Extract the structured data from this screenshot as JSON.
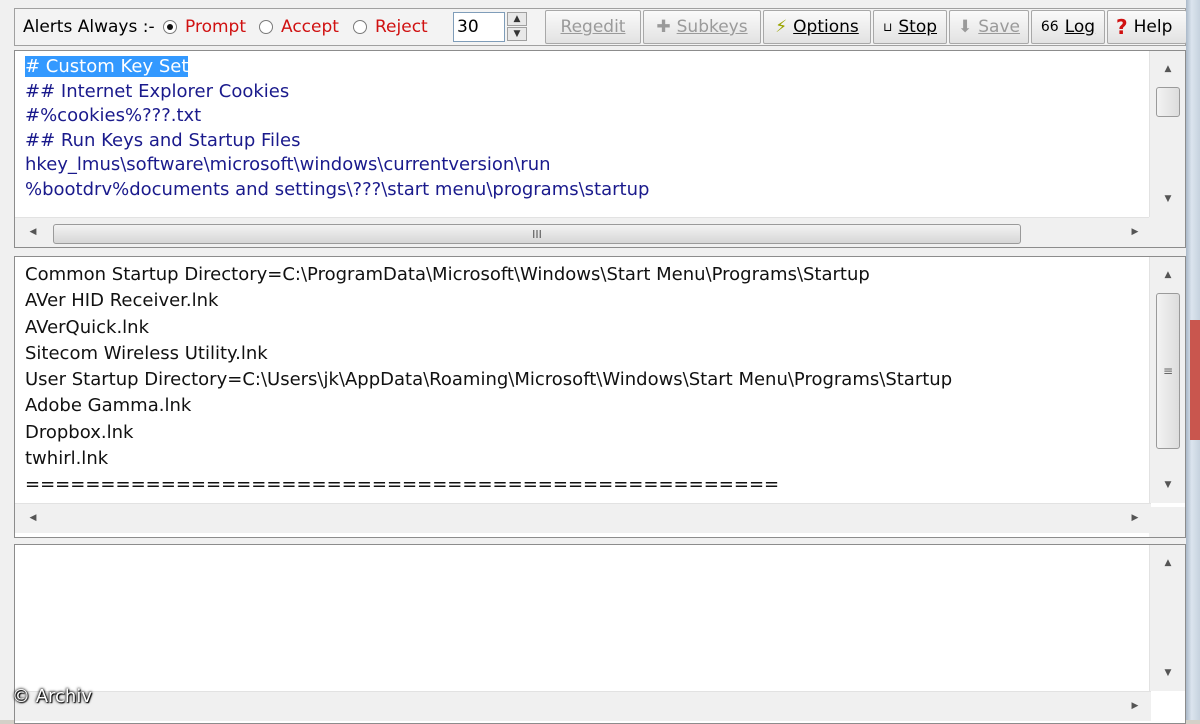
{
  "toolbar": {
    "alerts_label": "Alerts Always :-",
    "radios": [
      {
        "label": "Prompt",
        "selected": true
      },
      {
        "label": "Accept",
        "selected": false
      },
      {
        "label": "Reject",
        "selected": false
      }
    ],
    "timeout_value": "30",
    "buttons": {
      "regedit": "Regedit",
      "subkeys": "Subkeys",
      "options": "Options",
      "stop": "Stop",
      "save": "Save",
      "log": "Log",
      "help": "Help"
    },
    "colors": {
      "radio_label": "#d01010"
    }
  },
  "key_pane": {
    "lines": [
      "# Custom Key Set",
      "## Internet Explorer Cookies",
      "#%cookies%???.txt",
      "## Run Keys and Startup Files",
      "hkey_lmus\\software\\microsoft\\windows\\currentversion\\run",
      "%bootdrv%documents and settings\\???\\start menu\\programs\\startup"
    ],
    "selected_line": "# Custom Key Set",
    "text_color": "#1a1a8c",
    "selection_color": "#3399ff"
  },
  "results_pane": {
    "lines": [
      "Common Startup Directory=C:\\ProgramData\\Microsoft\\Windows\\Start Menu\\Programs\\Startup",
      "AVer HID Receiver.lnk",
      "AVerQuick.lnk",
      "Sitecom Wireless Utility.lnk",
      "User Startup Directory=C:\\Users\\jk\\AppData\\Roaming\\Microsoft\\Windows\\Start Menu\\Programs\\Startup",
      "Adobe Gamma.lnk",
      "Dropbox.lnk",
      "twhirl.lnk",
      "=================================================="
    ]
  },
  "log_pane": {
    "lines": []
  },
  "watermark": "© Archiv"
}
